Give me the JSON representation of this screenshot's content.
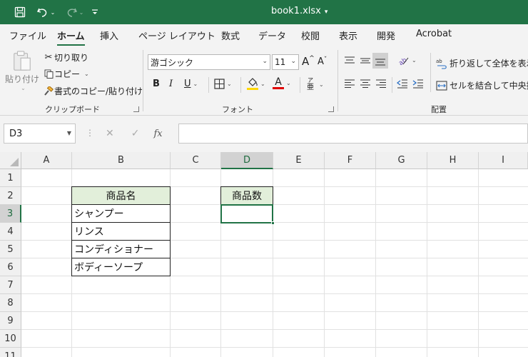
{
  "titlebar": {
    "filename": "book1.xlsx",
    "save_icon": "save-icon",
    "undo_icon": "undo-icon",
    "redo_icon": "redo-icon",
    "customize_icon": "customize-quick-access-icon"
  },
  "tabs": [
    "ファイル",
    "ホーム",
    "挿入",
    "ページ レイアウト",
    "数式",
    "データ",
    "校閲",
    "表示",
    "開発",
    "Acrobat"
  ],
  "active_tab": "ホーム",
  "ribbon": {
    "clipboard": {
      "label": "クリップボード",
      "paste": "貼り付け",
      "cut": "切り取り",
      "copy": "コピー",
      "format_painter": "書式のコピー/貼り付け"
    },
    "font": {
      "label": "フォント",
      "font_name": "游ゴシック",
      "font_size": "11",
      "grow": "A",
      "shrink": "A",
      "bold": "B",
      "italic": "I",
      "underline": "U",
      "font_color_letter": "A",
      "phonetic_top": "ア",
      "phonetic_bottom": "亜"
    },
    "alignment": {
      "label": "配置",
      "wrap_text": "折り返して全体を表示す",
      "merge_center": "セルを結合して中央揃え"
    }
  },
  "colors": {
    "excel_green": "#217346",
    "header_fill": "#e2efda",
    "font_color_bar": "#e00000",
    "fill_color_bar": "#ffd700"
  },
  "formula_bar": {
    "name_box": "D3",
    "fx": "fx",
    "cancel": "✕",
    "enter": "✓",
    "content": ""
  },
  "grid": {
    "columns": [
      "A",
      "B",
      "C",
      "D",
      "E",
      "F",
      "G",
      "H",
      "I"
    ],
    "rows": [
      "1",
      "2",
      "3",
      "4",
      "5",
      "6",
      "7",
      "8",
      "9",
      "10",
      "11"
    ],
    "selected_column": "D",
    "selected_row": "3",
    "cells": {
      "B2": "商品名",
      "B3": "シャンプー",
      "B4": "リンス",
      "B5": "コンディショナー",
      "B6": "ボディーソープ",
      "D2": "商品数",
      "D3": ""
    }
  }
}
